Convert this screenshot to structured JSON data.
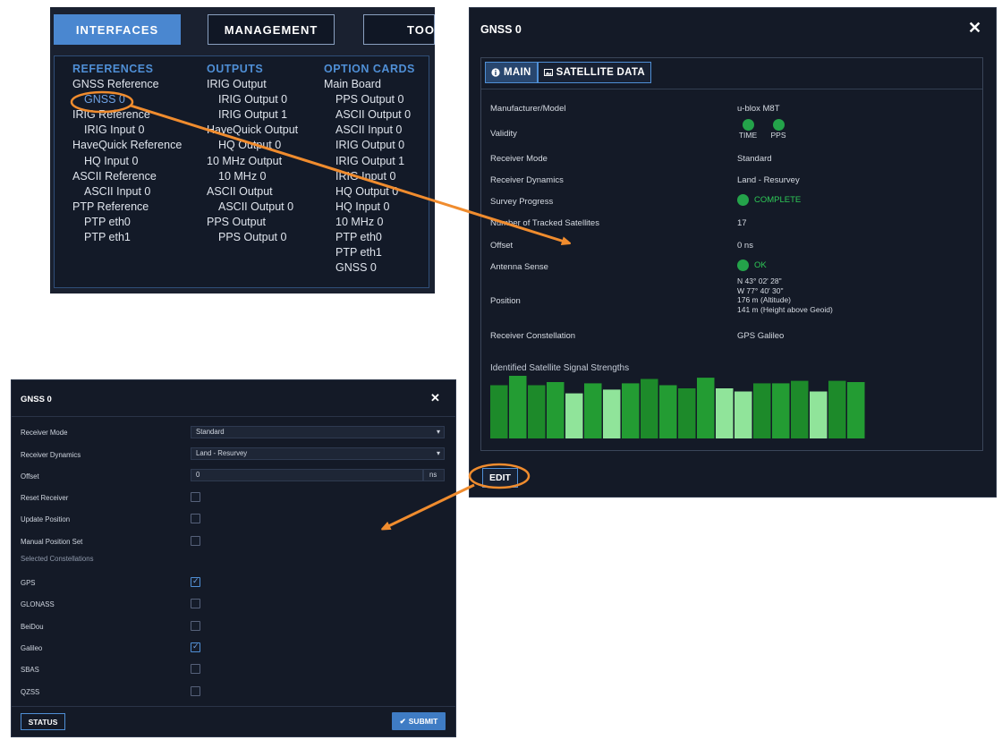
{
  "menu": {
    "tabs": {
      "interfaces": "INTERFACES",
      "management": "MANAGEMENT",
      "tools": "TOOL"
    },
    "columns": {
      "references": {
        "header": "REFERENCES",
        "items": [
          {
            "label": "GNSS Reference",
            "sub": false
          },
          {
            "label": "GNSS 0",
            "sub": true
          },
          {
            "label": "IRIG Reference",
            "sub": false
          },
          {
            "label": "IRIG Input 0",
            "sub": true
          },
          {
            "label": "HaveQuick Reference",
            "sub": false
          },
          {
            "label": "HQ Input 0",
            "sub": true
          },
          {
            "label": "ASCII Reference",
            "sub": false
          },
          {
            "label": "ASCII Input 0",
            "sub": true
          },
          {
            "label": "PTP Reference",
            "sub": false
          },
          {
            "label": "PTP eth0",
            "sub": true
          },
          {
            "label": "PTP eth1",
            "sub": true
          }
        ]
      },
      "outputs": {
        "header": "OUTPUTS",
        "items": [
          {
            "label": "IRIG Output",
            "sub": false
          },
          {
            "label": "IRIG Output 0",
            "sub": true
          },
          {
            "label": "IRIG Output 1",
            "sub": true
          },
          {
            "label": "HaveQuick Output",
            "sub": false
          },
          {
            "label": "HQ Output 0",
            "sub": true
          },
          {
            "label": "10 MHz Output",
            "sub": false
          },
          {
            "label": "10 MHz 0",
            "sub": true
          },
          {
            "label": "ASCII Output",
            "sub": false
          },
          {
            "label": "ASCII Output 0",
            "sub": true
          },
          {
            "label": "PPS Output",
            "sub": false
          },
          {
            "label": "PPS Output 0",
            "sub": true
          }
        ]
      },
      "option_cards": {
        "header": "OPTION CARDS",
        "items": [
          {
            "label": "Main Board",
            "sub": false
          },
          {
            "label": "PPS Output 0",
            "sub": true
          },
          {
            "label": "ASCII Output 0",
            "sub": true
          },
          {
            "label": "ASCII Input 0",
            "sub": true
          },
          {
            "label": "IRIG Output 0",
            "sub": true
          },
          {
            "label": "IRIG Output 1",
            "sub": true
          },
          {
            "label": "IRIG Input 0",
            "sub": true
          },
          {
            "label": "HQ Output 0",
            "sub": true
          },
          {
            "label": "HQ Input 0",
            "sub": true
          },
          {
            "label": "10 MHz 0",
            "sub": true
          },
          {
            "label": "PTP eth0",
            "sub": true
          },
          {
            "label": "PTP eth1",
            "sub": true
          },
          {
            "label": "GNSS 0",
            "sub": true
          }
        ]
      }
    }
  },
  "info_modal": {
    "title": "GNSS 0",
    "close": "✕",
    "tabs": {
      "main": "MAIN",
      "satellite": "SATELLITE DATA"
    },
    "rows": {
      "manufacturer_label": "Manufacturer/Model",
      "manufacturer_value": "u-blox M8T",
      "validity_label": "Validity",
      "validity_time": "TIME",
      "validity_pps": "PPS",
      "receiver_mode_label": "Receiver Mode",
      "receiver_mode_value": "Standard",
      "receiver_dynamics_label": "Receiver Dynamics",
      "receiver_dynamics_value": "Land - Resurvey",
      "survey_label": "Survey Progress",
      "survey_value": "COMPLETE",
      "tracked_label": "Number of Tracked Satellites",
      "tracked_value": "17",
      "offset_label": "Offset",
      "offset_value": "0 ns",
      "antenna_label": "Antenna Sense",
      "antenna_value": "OK",
      "position_label": "Position",
      "position_lines": [
        "N 43° 02' 28\"",
        "W 77° 40' 30\"",
        "176 m (Altitude)",
        "141 m (Height above Geoid)"
      ],
      "constellation_label": "Receiver Constellation",
      "constellation_value": "GPS Galileo"
    },
    "signal_title": "Identified Satellite Signal Strengths",
    "signal_levels": [
      0.85,
      1.0,
      0.85,
      0.9,
      0.72,
      0.88,
      0.78,
      0.88,
      0.95,
      0.85,
      0.8,
      0.97,
      0.8,
      0.75,
      0.88,
      0.88,
      0.92,
      0.75,
      0.92,
      0.9
    ],
    "signal_colors": {
      "strong": "#1d8a2a",
      "mid": "#239c33",
      "weak": "#90e49a"
    },
    "signal_weak_flags": [
      false,
      false,
      false,
      false,
      true,
      false,
      true,
      false,
      false,
      false,
      false,
      false,
      true,
      true,
      false,
      false,
      false,
      true,
      false,
      false
    ],
    "edit": "EDIT"
  },
  "edit_modal": {
    "title": "GNSS 0",
    "close": "✕",
    "fields": {
      "receiver_mode_label": "Receiver Mode",
      "receiver_mode_value": "Standard",
      "receiver_dynamics_label": "Receiver Dynamics",
      "receiver_dynamics_value": "Land - Resurvey",
      "offset_label": "Offset",
      "offset_value": "0",
      "offset_unit": "ns",
      "reset_label": "Reset Receiver",
      "update_label": "Update Position",
      "manual_label": "Manual Position Set",
      "constellations_header": "Selected Constellations"
    },
    "constellations": [
      {
        "label": "GPS",
        "checked": true
      },
      {
        "label": "GLONASS",
        "checked": false
      },
      {
        "label": "BeiDou",
        "checked": false
      },
      {
        "label": "Galileo",
        "checked": true
      },
      {
        "label": "SBAS",
        "checked": false
      },
      {
        "label": "QZSS",
        "checked": false
      }
    ],
    "status": "STATUS",
    "submit": "SUBMIT"
  },
  "colors": {
    "accent": "#4f8fd6",
    "annotation": "#f08c2e",
    "panel_bg": "#141a27",
    "ok_green": "#24a34a"
  }
}
